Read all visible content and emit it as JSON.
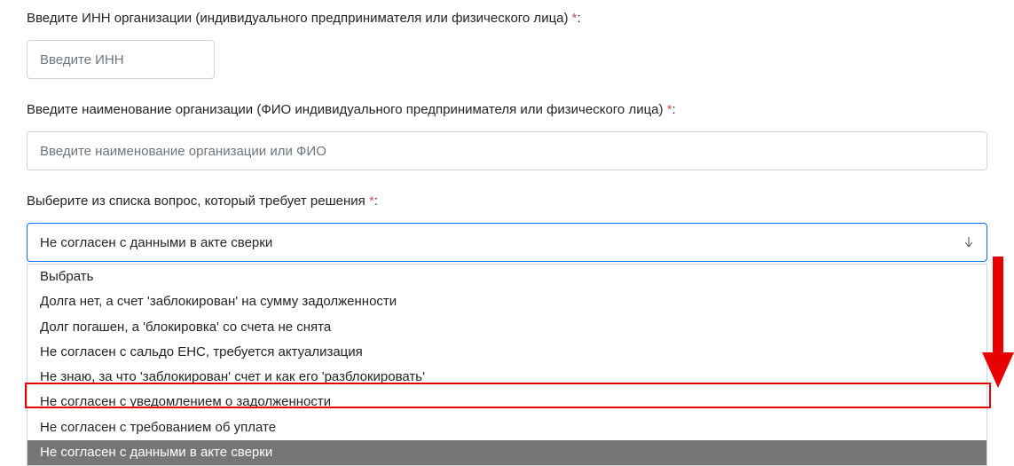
{
  "fields": {
    "inn": {
      "label": "Введите ИНН организации (индивидуального предпринимателя или физического лица)",
      "placeholder": "Введите ИНН",
      "required_mark": "*",
      "colon": ":"
    },
    "orgname": {
      "label": "Введите наименование организации (ФИО индивидуального предпринимателя или физического лица)",
      "placeholder": "Введите наименование организации или ФИО",
      "required_mark": "*",
      "colon": ":"
    },
    "question": {
      "label": "Выберите из списка вопрос, который требует решения",
      "required_mark": "*",
      "colon": ":",
      "selected": "Не согласен с данными в акте сверки",
      "options": [
        "Выбрать",
        "Долга нет, а счет 'заблокирован' на сумму задолженности",
        "Долг погашен, а 'блокировка' со счета не снята",
        "Не согласен с сальдо ЕНС, требуется актуализация",
        "Не знаю, за что 'заблокирован' счет и как его 'разблокировать'",
        "Не согласен с уведомлением о задолженности",
        "Не согласен с требованием об уплате",
        "Не согласен с данными в акте сверки"
      ],
      "highlighted_index": 7
    }
  },
  "colors": {
    "focus_border": "#0d6efd",
    "required": "#d9534f",
    "annotation": "#e60000"
  }
}
